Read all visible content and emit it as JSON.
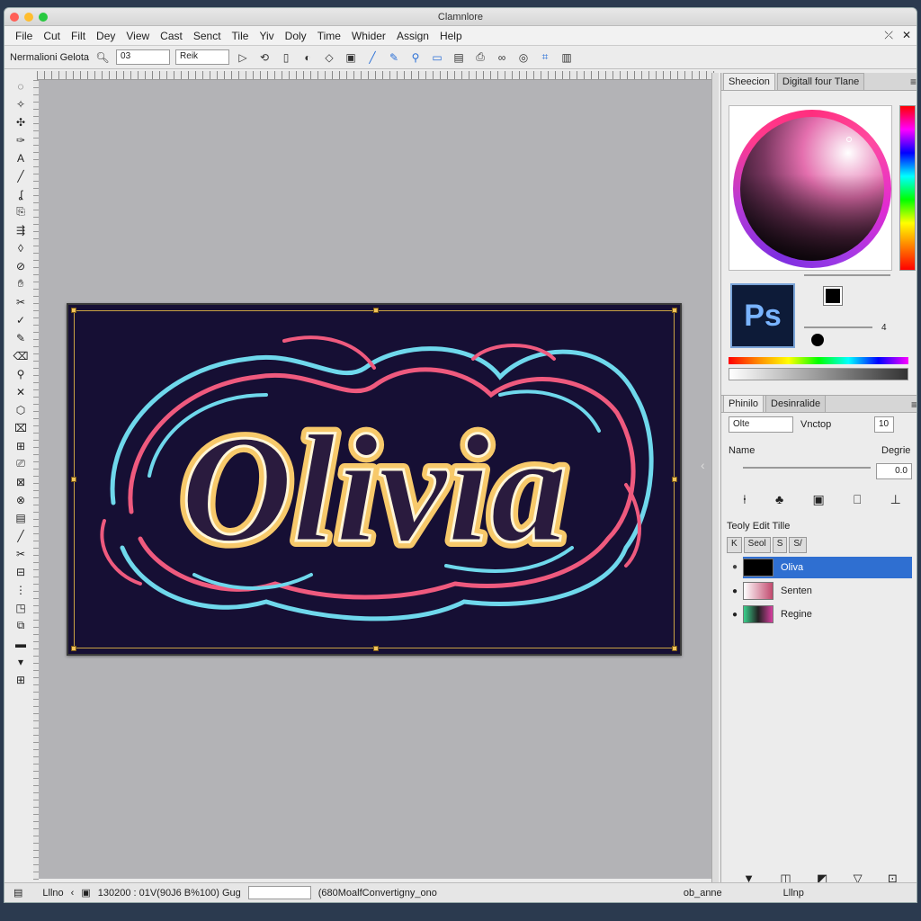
{
  "window": {
    "title": "Clamnlore",
    "traffic_colors": [
      "#ff5f57",
      "#ffbd2e",
      "#28c940"
    ]
  },
  "menu": [
    "File",
    "Cut",
    "Filt",
    "Dey",
    "View",
    "Cast",
    "Senct",
    "Tile",
    "Yiv",
    "Doly",
    "Time",
    "Whider",
    "Assign",
    "Help"
  ],
  "options_bar": {
    "label": "Nermalioni Gelota",
    "field1": "03",
    "field2": "Reik"
  },
  "toolbox": {
    "icons": [
      "lasso-icon",
      "wand-icon",
      "move-icon",
      "pen-icon",
      "type-icon",
      "brush-icon",
      "smudge-icon",
      "clone-icon",
      "gradient-icon",
      "blur-icon",
      "path-icon",
      "hand-icon",
      "check-icon",
      "pencil-icon",
      "scissors-icon",
      "zoom-icon",
      "dodge-icon",
      "shape-icon",
      "crop-icon",
      "heal-icon",
      "eyedropper-icon",
      "stamp-icon",
      "bucket-icon",
      "measure-icon",
      "note-icon",
      "slice-icon",
      "frame-icon",
      "layers-icon",
      "grid-icon"
    ]
  },
  "artboard": {
    "text": "Olivia",
    "bg": "#160f34",
    "letter_color": "#f7c96a",
    "swirl_cyan": "#6fd8ec",
    "swirl_pink": "#ef5a7e"
  },
  "color_panel": {
    "tabs": [
      "Sheecion",
      "Digitall four Tlane"
    ],
    "ps_label": "Ps",
    "value": "4"
  },
  "props_panel": {
    "tabs": [
      "Phinilo",
      "Desinralide"
    ],
    "field1": "Olte",
    "label1": "Vnctop",
    "field2": "10",
    "name_label": "Name",
    "degrie_label": "Degrie",
    "value_field": "0.0"
  },
  "layers_panel": {
    "title": "Teoly Edit Tille",
    "tabs": [
      "K",
      "Seol",
      "S",
      "S/"
    ],
    "layers": [
      {
        "name": "Oliva",
        "selected": true
      },
      {
        "name": "Senten",
        "selected": false
      },
      {
        "name": "Regine",
        "selected": false
      }
    ]
  },
  "status_bar": {
    "item1": "Lllno",
    "item2": "130200 : 01V(90J6 B%100) Gug",
    "item3": "(680MoalfConvertigny_ono",
    "item4": "ob_anne",
    "item5": "Lllnp"
  }
}
